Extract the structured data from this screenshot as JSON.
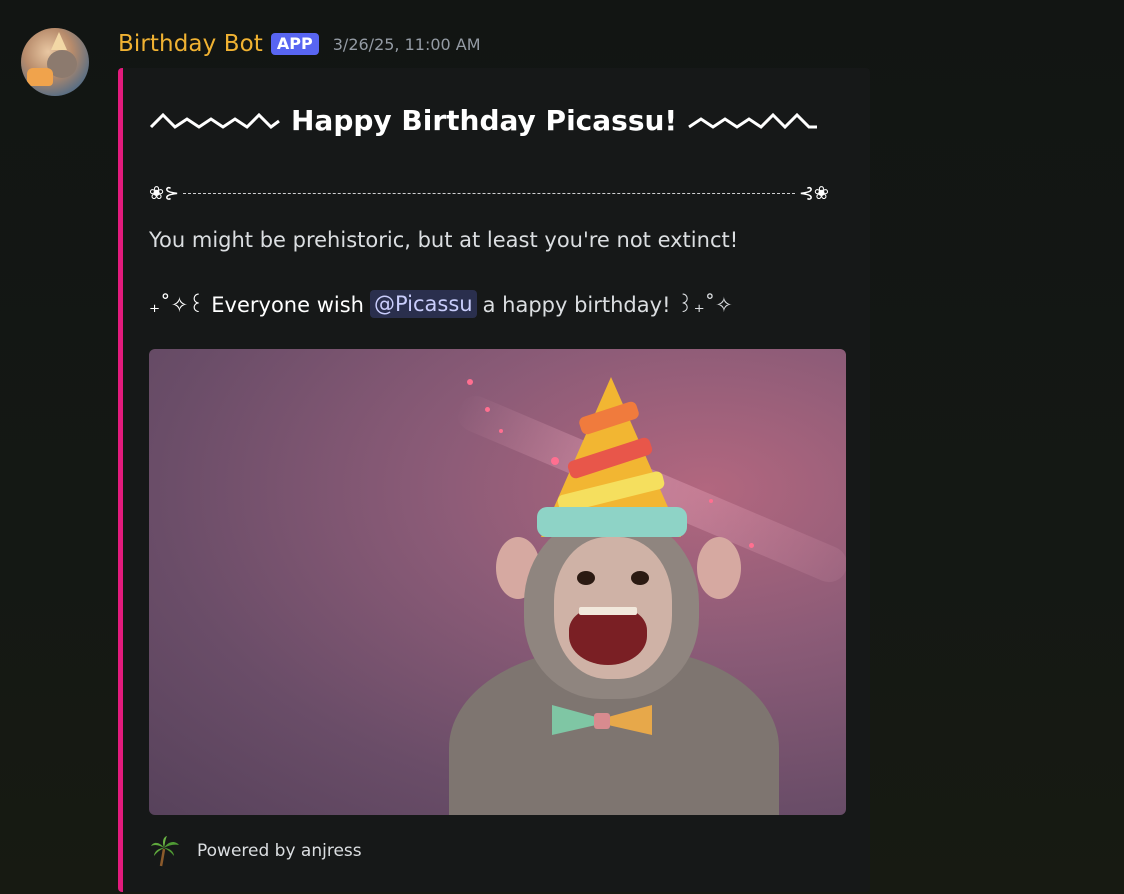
{
  "message": {
    "author": "Birthday Bot",
    "badge": "APP",
    "timestamp": "3/26/25, 11:00 AM"
  },
  "embed": {
    "accent_color": "#e31b7d",
    "title": "Happy Birthday Picassu!",
    "divider_left": "❀⊱",
    "divider_right": "⊰❀",
    "description_line1": "You might be prehistoric, but at least you're not extinct!",
    "line2_prefix": "₊˚✧꒰ Everyone wish",
    "mention": "@Picassu",
    "line2_suffix": "a happy birthday! ꒱₊˚✧",
    "image_alt": "monkey-wearing-party-hat",
    "footer_text": "Powered by anjress",
    "footer_icon": "palm-tree-icon"
  },
  "colors": {
    "username": "#f0b232",
    "app_badge": "#5865f2",
    "mention_bg": "#2a2f4d",
    "mention_text": "#c9cdfb"
  }
}
